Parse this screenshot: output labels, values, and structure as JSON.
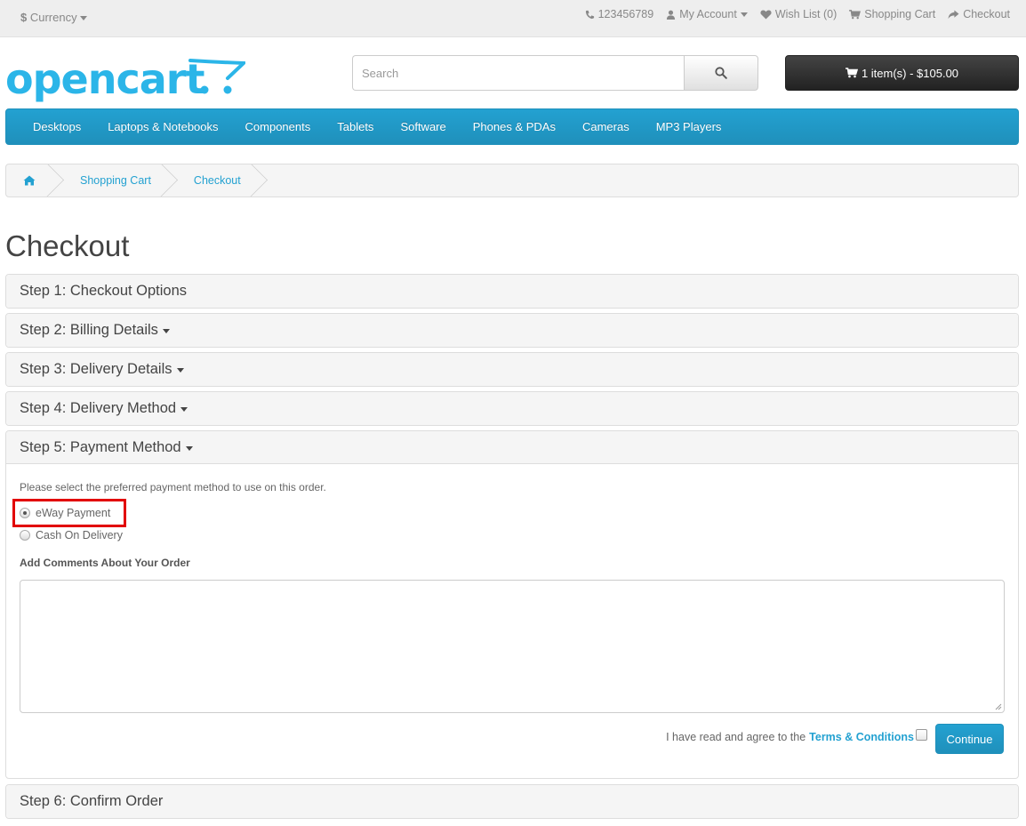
{
  "topbar": {
    "currency_symbol": "$",
    "currency_label": "Currency",
    "phone": "123456789",
    "my_account": "My Account",
    "wishlist": "Wish List (0)",
    "shopping_cart": "Shopping Cart",
    "checkout": "Checkout"
  },
  "header": {
    "logo_text": "opencart",
    "search_placeholder": "Search",
    "cart_label": "1 item(s) - $105.00"
  },
  "menu": {
    "items": [
      "Desktops",
      "Laptops & Notebooks",
      "Components",
      "Tablets",
      "Software",
      "Phones & PDAs",
      "Cameras",
      "MP3 Players"
    ]
  },
  "breadcrumb": {
    "items": [
      "Shopping Cart",
      "Checkout"
    ]
  },
  "page": {
    "title": "Checkout"
  },
  "steps": [
    {
      "label": "Step 1: Checkout Options",
      "caret": false
    },
    {
      "label": "Step 2: Billing Details",
      "caret": true
    },
    {
      "label": "Step 3: Delivery Details",
      "caret": true
    },
    {
      "label": "Step 4: Delivery Method",
      "caret": true
    },
    {
      "label": "Step 5: Payment Method",
      "caret": true
    },
    {
      "label": "Step 6: Confirm Order",
      "caret": false
    }
  ],
  "payment": {
    "intro": "Please select the preferred payment method to use on this order.",
    "options": [
      {
        "label": "eWay Payment",
        "selected": true
      },
      {
        "label": "Cash On Delivery",
        "selected": false
      }
    ],
    "comments_label": "Add Comments About Your Order",
    "comments_value": "",
    "agree_text": "I have read and agree to the",
    "terms_link": "Terms & Conditions",
    "continue_label": "Continue"
  },
  "colors": {
    "accent": "#23a1d1",
    "highlight": "#e20000",
    "cart_button": "#333333"
  }
}
